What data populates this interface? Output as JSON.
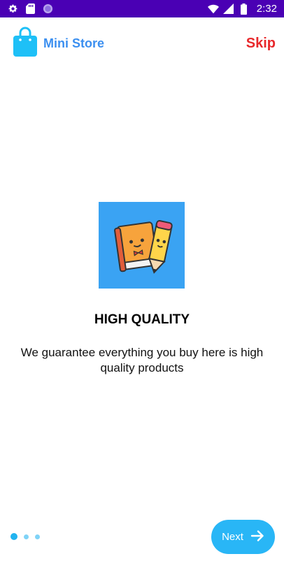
{
  "status_bar": {
    "time": "2:32",
    "left_icons": [
      "gear-icon",
      "sd-card-icon",
      "circle-notification-icon"
    ],
    "right_icons": [
      "wifi-icon",
      "signal-icon",
      "battery-icon"
    ]
  },
  "header": {
    "app_name": "Mini Store",
    "skip_label": "Skip"
  },
  "slide": {
    "title": "HIGH QUALITY",
    "description": "We guarantee everything you buy here is high quality products",
    "illustration": "book-and-pencil-icon"
  },
  "pager": {
    "total": 3,
    "active_index": 0
  },
  "footer": {
    "next_label": "Next"
  },
  "colors": {
    "status_bar": "#4a00b4",
    "brand": "#3b8ff0",
    "skip": "#e8282b",
    "accent": "#29b6f6"
  }
}
